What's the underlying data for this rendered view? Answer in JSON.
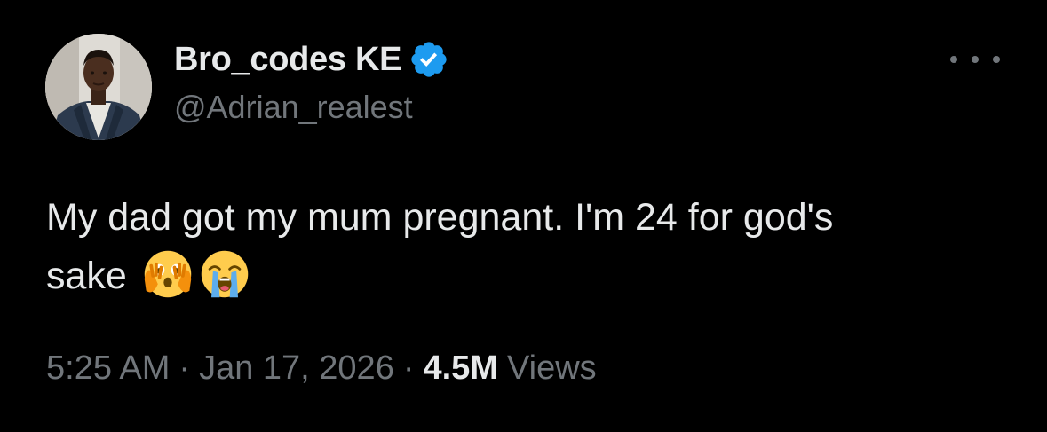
{
  "author": {
    "display_name": "Bro_codes KE",
    "handle": "@Adrian_realest",
    "verified": true,
    "verified_color": "#1d9bf0",
    "avatar_icon": "profile-photo"
  },
  "more_icon": "more-horizontal-icon",
  "tweet": {
    "text_line1": "My dad got my mum pregnant. I'm 24 for god's",
    "text_line2": "sake",
    "emojis": [
      "face-with-open-eyes-and-hand-over-mouth",
      "loudly-crying-face"
    ]
  },
  "meta": {
    "time": "5:25 AM",
    "separator": "·",
    "date": "Jan 17, 2026",
    "views_count": "4.5M",
    "views_label": "Views"
  },
  "colors": {
    "background": "#000000",
    "text_primary": "#e7e9ea",
    "text_secondary": "#71767b"
  }
}
